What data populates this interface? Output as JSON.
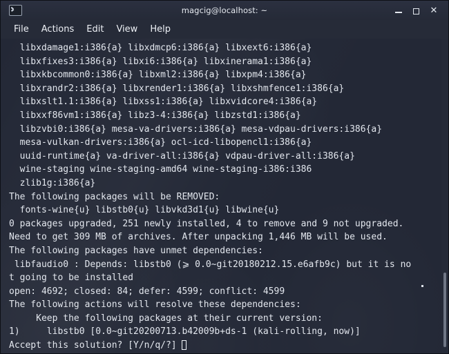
{
  "window": {
    "title": "magcig@localhost: ~",
    "icon": "terminal-icon",
    "controls": {
      "minimize": "_",
      "maximize": "□",
      "close": "✕"
    }
  },
  "menubar": {
    "items": [
      {
        "label": "File"
      },
      {
        "label": "Actions"
      },
      {
        "label": "Edit"
      },
      {
        "label": "View"
      },
      {
        "label": "Help"
      }
    ]
  },
  "terminal": {
    "colors": {
      "background": "#232836",
      "foreground": "#e3e7ee",
      "titlebar": "#2b3040",
      "scrollbar_thumb": "#6f7685"
    },
    "lines": [
      "  libxdamage1:i386{a} libxdmcp6:i386{a} libxext6:i386{a}",
      "  libxfixes3:i386{a} libxi6:i386{a} libxinerama1:i386{a}",
      "  libxkbcommon0:i386{a} libxml2:i386{a} libxpm4:i386{a}",
      "  libxrandr2:i386{a} libxrender1:i386{a} libxshmfence1:i386{a}",
      "  libxslt1.1:i386{a} libxss1:i386{a} libxvidcore4:i386{a}",
      "  libxxf86vm1:i386{a} libz3-4:i386{a} libzstd1:i386{a}",
      "  libzvbi0:i386{a} mesa-va-drivers:i386{a} mesa-vdpau-drivers:i386{a}",
      "  mesa-vulkan-drivers:i386{a} ocl-icd-libopencl1:i386{a}",
      "  uuid-runtime{a} va-driver-all:i386{a} vdpau-driver-all:i386{a}",
      "  wine-staging wine-staging-amd64 wine-staging-i386:i386",
      "  zlib1g:i386{a}",
      "The following packages will be REMOVED:",
      "  fonts-wine{u} libstb0{u} libvkd3d1{u} libwine{u}",
      "0 packages upgraded, 251 newly installed, 4 to remove and 9 not upgraded.",
      "Need to get 309 MB of archives. After unpacking 1,446 MB will be used.",
      "The following packages have unmet dependencies:",
      " libfaudio0 : Depends: libstb0 (⩾ 0.0~git20180212.15.e6afb9c) but it is no",
      "t going to be installed",
      "open: 4692; closed: 84; defer: 4599; conflict: 4599",
      "The following actions will resolve these dependencies:",
      "",
      "     Keep the following packages at their current version:",
      "1)     libstb0 [0.0~git20200713.b42009b+ds-1 (kali-rolling, now)]",
      "",
      "",
      "",
      "Accept this solution? [Y/n/q/?]"
    ],
    "prompt_text": "Accept this solution? [Y/n/q/?]",
    "cursor": "block-hollow",
    "resolver_status_dot": true
  },
  "scrollbar": {
    "thumb_top_pct": 74,
    "thumb_height_pct": 24
  }
}
